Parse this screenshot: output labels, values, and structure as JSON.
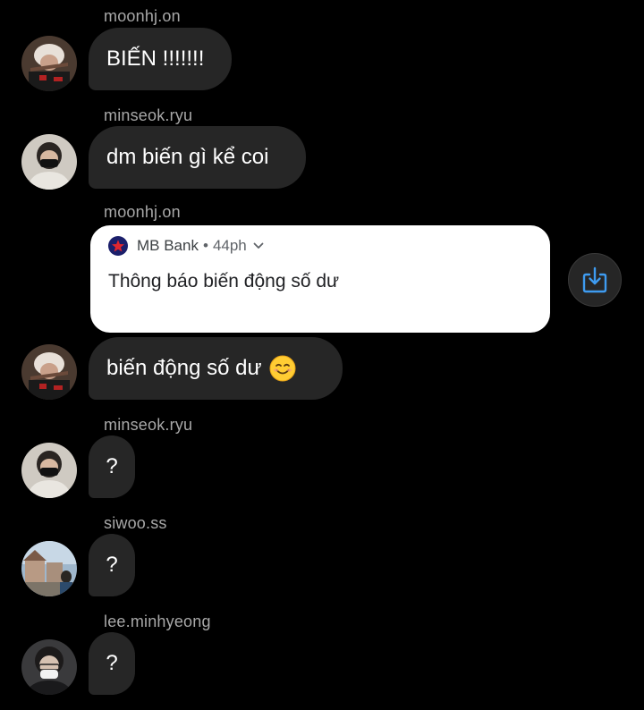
{
  "colors": {
    "background": "#000000",
    "bubble": "#262626",
    "username": "#a8a8a8",
    "accent": "#3e9bf0"
  },
  "messages": [
    {
      "username": "moonhj.on",
      "text": "BIẾN !!!!!!!"
    },
    {
      "username": "minseok.ryu",
      "text": "dm biến gì kể coi"
    },
    {
      "username": "moonhj.on"
    },
    {
      "text": "biến động số dư",
      "emoji": "smiling-face-emoji"
    },
    {
      "username": "minseok.ryu",
      "text": "?"
    },
    {
      "username": "siwoo.ss",
      "text": "?"
    },
    {
      "username": "lee.minhyeong",
      "text": "?"
    }
  ],
  "notification": {
    "app_name": "MB Bank",
    "separator": "•",
    "time": "44ph",
    "title": "Thông báo biến động số dư",
    "icon": "mb-bank-logo-icon"
  },
  "share_button": {
    "icon": "share-download-icon"
  }
}
